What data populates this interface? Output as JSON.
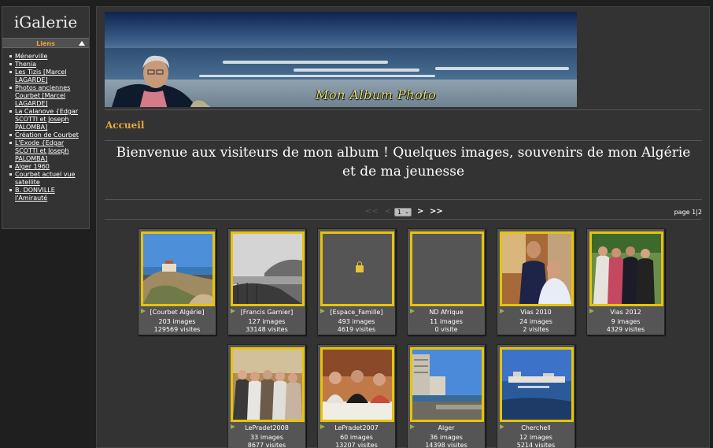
{
  "sidebar": {
    "site_title": "iGalerie",
    "links_header": "Liens",
    "links": [
      "Ménerville",
      "Thenia",
      "Les Tizis [Marcel LAGARDE]",
      "Photos anciennes Courbet [Marcel LAGARDE]",
      "La Calanove {Edgar SCOTTI et Joseph PALOMBA]",
      "Création de Courbet",
      "L'Exode {Edgar SCOTTI et Joseph PALOMBA]",
      "Alger 1960",
      "Courbet actuel vue satellite",
      "B. DONVILLE l'Amirauté"
    ]
  },
  "banner": {
    "caption": "Mon Album Photo"
  },
  "breadcrumb": "Accueil",
  "welcome": {
    "line1": "Bienvenue aux visiteurs de mon album ! Quelques images, souvenirs de mon Algérie",
    "line2": "et de ma jeunesse"
  },
  "pagination": {
    "first": "<<",
    "prev": "<",
    "current": "1",
    "next": ">",
    "last": ">>",
    "page_info": "page 1|2"
  },
  "albums": [
    {
      "title": "[Courbet Algérie]",
      "count": "203 images",
      "visits": "129569 visites",
      "image": "coastal-village-photo"
    },
    {
      "title": "[Francis Garnier]",
      "count": "127 images",
      "visits": "33148 visites",
      "image": "bw-coast-photo"
    },
    {
      "title": "[Espace_Famille]",
      "count": "493 images",
      "visits": "4619 visites",
      "image": "locked"
    },
    {
      "title": "ND Afrique",
      "count": "11 images",
      "visits": "0 visite",
      "image": "empty"
    },
    {
      "title": "Vias 2010",
      "count": "24 images",
      "visits": "2 visites",
      "image": "two-men-photo"
    },
    {
      "title": "Vias 2012",
      "count": "9 images",
      "visits": "4329 visites",
      "image": "group-photo"
    },
    {
      "title": "LePradet2008",
      "count": "33 images",
      "visits": "8677 visites",
      "image": "women-group-photo"
    },
    {
      "title": "LePradet2007",
      "count": "60 images",
      "visits": "13207 visites",
      "image": "dinner-photo"
    },
    {
      "title": "Alger",
      "count": "36 images",
      "visits": "14398 visites",
      "image": "alger-harbor-photo"
    },
    {
      "title": "Cherchell",
      "count": "12 images",
      "visits": "5214 visites",
      "image": "cherchell-harbor-photo"
    }
  ],
  "colors": {
    "accent": "#e8a640",
    "thumb_border": "#e5c40a",
    "panel": "#333333"
  }
}
